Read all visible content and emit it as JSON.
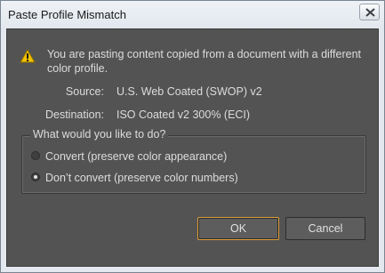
{
  "window": {
    "title": "Paste Profile Mismatch",
    "close_icon": "close-icon"
  },
  "dialog": {
    "icon": "warning-icon",
    "icon_color": "#f2c200",
    "message": "You are pasting content copied from a document with a different color profile.",
    "source_label": "Source:",
    "source_value": "U.S. Web Coated (SWOP) v2",
    "destination_label": "Destination:",
    "destination_value": "ISO Coated v2 300% (ECI)",
    "question": "What would you like to do?",
    "options": [
      {
        "label": "Convert (preserve color appearance)",
        "checked": false
      },
      {
        "label": "Don’t convert (preserve color numbers)",
        "checked": true
      }
    ],
    "ok_label": "OK",
    "cancel_label": "Cancel",
    "accent_color": "#e0a03a"
  }
}
